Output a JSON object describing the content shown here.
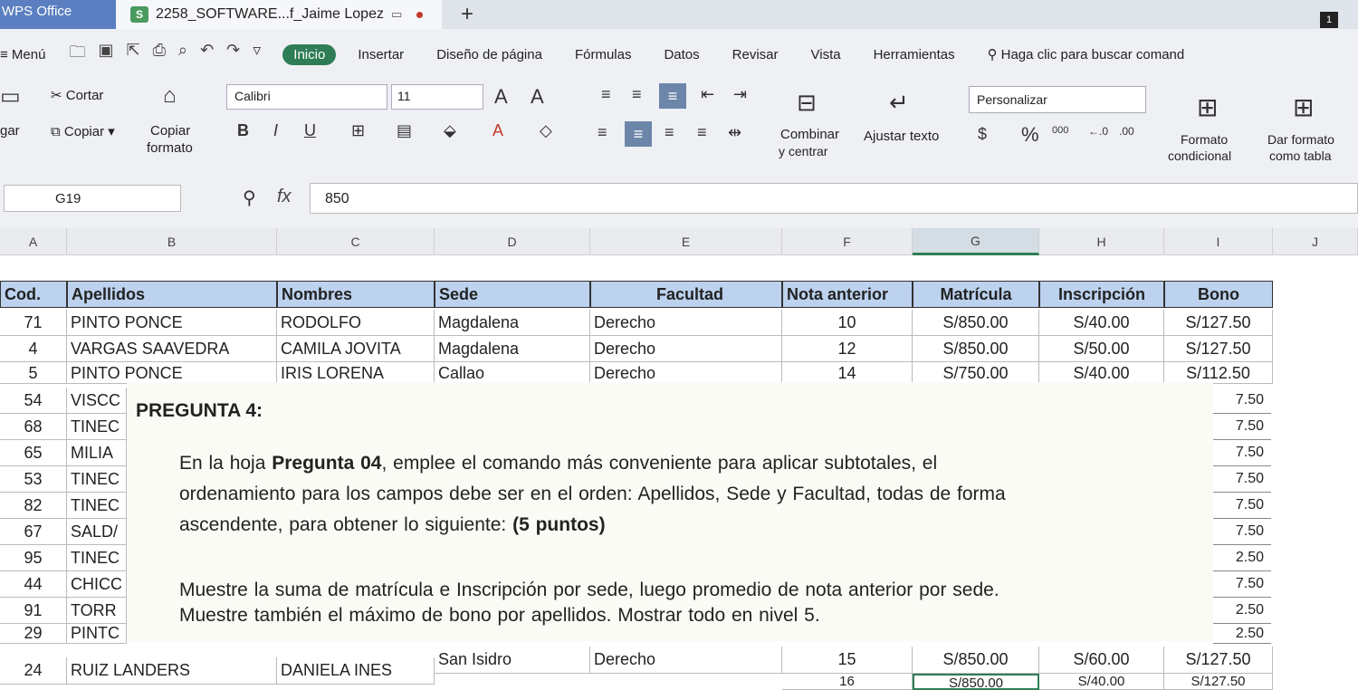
{
  "titlebar": {
    "app_tab": "WPS Office",
    "doc_tab_badge": "S",
    "doc_title": "2258_SOFTWARE...f_Jaime Lopez",
    "new_tab": "+",
    "corner_badge": "1"
  },
  "menubar": {
    "menu_label": "Menú",
    "tabs": [
      {
        "label": "Inicio",
        "active": true
      },
      {
        "label": "Insertar"
      },
      {
        "label": "Diseño de página"
      },
      {
        "label": "Fórmulas"
      },
      {
        "label": "Datos"
      },
      {
        "label": "Revisar"
      },
      {
        "label": "Vista"
      },
      {
        "label": "Herramientas"
      }
    ],
    "search_label": "Haga clic para buscar comand"
  },
  "ribbon": {
    "cut": "Cortar",
    "copy": "Copiar",
    "paste_partial": "gar",
    "copy_format_1": "Copiar",
    "copy_format_2": "formato",
    "font_name": "Calibri",
    "font_size": "11",
    "merge_1": "Combinar",
    "merge_2": "y centrar",
    "wrap_text": "Ajustar texto",
    "number_format": "Personalizar",
    "cond_format_1": "Formato",
    "cond_format_2": "condicional",
    "table_format_1": "Dar formato",
    "table_format_2": "como tabla",
    "percent": "%",
    "thousands": "000",
    "bold": "B",
    "italic": "I",
    "underline": "U",
    "grow_font": "A",
    "shrink_font": "A"
  },
  "formula": {
    "name_box": "G19",
    "fx": "fx",
    "value": "850"
  },
  "columns": [
    "A",
    "B",
    "C",
    "D",
    "E",
    "F",
    "G",
    "H",
    "I",
    "J"
  ],
  "table": {
    "headers": [
      "Cod.",
      "Apellidos",
      "Nombres",
      "Sede",
      "Facultad",
      "Nota anterior",
      "Matrícula",
      "Inscripción",
      "Bono"
    ],
    "top_rows": [
      [
        "71",
        "PINTO PONCE",
        "RODOLFO",
        "Magdalena",
        "Derecho",
        "10",
        "S/850.00",
        "S/40.00",
        "S/127.50"
      ],
      [
        "4",
        "VARGAS SAAVEDRA",
        "CAMILA JOVITA",
        "Magdalena",
        "Derecho",
        "12",
        "S/850.00",
        "S/50.00",
        "S/127.50"
      ],
      [
        "5",
        "PINTO PONCE",
        "IRIS LORENA",
        "Callao",
        "Derecho",
        "14",
        "S/750.00",
        "S/40.00",
        "S/112.50"
      ]
    ],
    "partial_rows": [
      {
        "cod": "54",
        "apellido": "VISCC",
        "bono": "7.50"
      },
      {
        "cod": "68",
        "apellido": "TINEC",
        "bono": "7.50"
      },
      {
        "cod": "65",
        "apellido": "MILIA",
        "bono": "7.50"
      },
      {
        "cod": "53",
        "apellido": "TINEC",
        "bono": "7.50"
      },
      {
        "cod": "82",
        "apellido": "TINEC",
        "bono": "7.50"
      },
      {
        "cod": "67",
        "apellido": "SALD/",
        "bono": "7.50"
      },
      {
        "cod": "95",
        "apellido": "TINEC",
        "bono": "2.50"
      },
      {
        "cod": "44",
        "apellido": "CHICC",
        "bono": "7.50"
      },
      {
        "cod": "91",
        "apellido": "TORR",
        "bono": "2.50"
      },
      {
        "cod": "29",
        "apellido": "PINTC",
        "bono": "2.50"
      }
    ],
    "bottom_rows": [
      [
        "24",
        "RUIZ LANDERS",
        "DANIELA INES",
        "San Isidro",
        "Derecho",
        "15",
        "S/850.00",
        "S/60.00",
        "S/127.50"
      ],
      [
        "",
        "",
        "",
        "",
        "",
        "16",
        "S/850.00",
        "S/40.00",
        "S/127.50"
      ]
    ]
  },
  "dialog": {
    "title": "PREGUNTA 4:",
    "line1_pre": "En la hoja ",
    "line1_bold": "Pregunta 04",
    "line1_post": ", emplee el comando más conveniente para aplicar subtotales, el",
    "line2": "ordenamiento para los campos debe ser en el orden: Apellidos, Sede y Facultad, todas de forma",
    "line3_pre": "ascendente, para obtener lo siguiente: ",
    "line3_bold": "(5 puntos)",
    "line4": "Muestre la suma de matrícula e Inscripción por sede, luego promedio de nota anterior por sede.",
    "line5": "Muestre también el máximo de bono por apellidos. Mostrar todo en nivel 5."
  },
  "colors": {
    "active_tab": "#2e7d57",
    "header_fill": "#bcd2ee",
    "app_tab": "#5b7fc1"
  }
}
